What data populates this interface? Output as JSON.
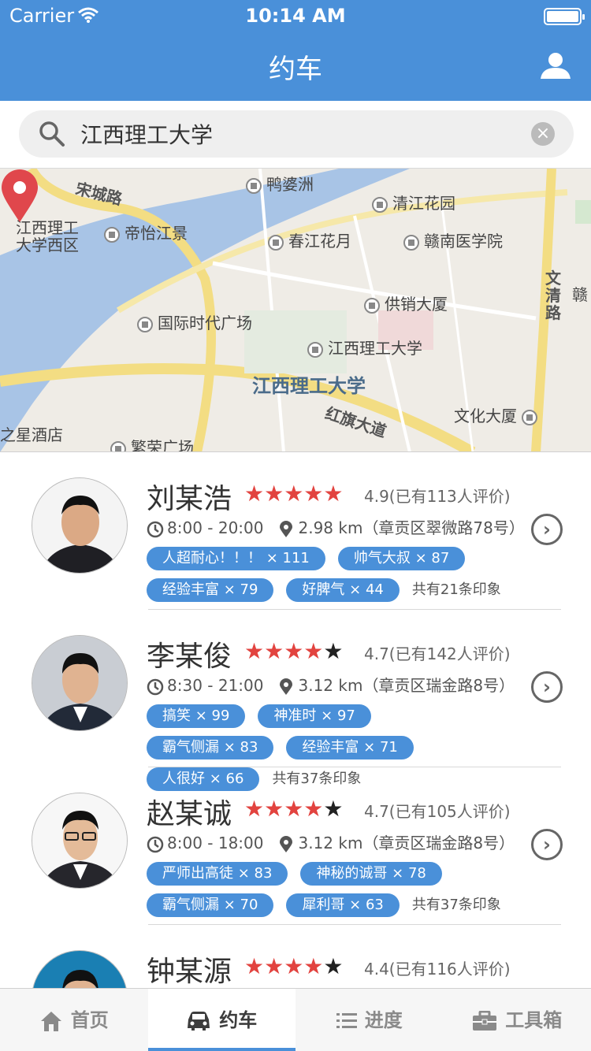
{
  "status": {
    "carrier": "Carrier",
    "time": "10:14 AM"
  },
  "header": {
    "title": "约车"
  },
  "search": {
    "value": "江西理工大学"
  },
  "map": {
    "roads": [
      "宋城路",
      "文清路",
      "红旗大道"
    ],
    "places": [
      "鸭婆洲",
      "清江花园",
      "江西理工大学西区",
      "帝怡江景",
      "春江花月",
      "赣南医学院",
      "供销大厦",
      "国际时代广场",
      "江西理工大学",
      "文化大厦",
      "之星酒店",
      "繁荣广场",
      "赣"
    ],
    "highlight": "江西理工大学"
  },
  "drivers": [
    {
      "name": "刘某浩",
      "stars": "★★★★★",
      "half": "",
      "rating": "4.9(已有113人评价)",
      "hours": "8:00 - 20:00",
      "distance": "2.98 km（章贡区翠微路78号）",
      "tags": [
        "人超耐心！！！ × 111",
        "帅气大叔 × 87",
        "经验丰富 × 79",
        "好脾气 × 44"
      ],
      "impressions": "共有21条印象"
    },
    {
      "name": "李某俊",
      "stars": "★★★★",
      "half": "★",
      "rating": "4.7(已有142人评价)",
      "hours": "8:30 - 21:00",
      "distance": "3.12 km（章贡区瑞金路8号）",
      "tags": [
        "搞笑 × 99",
        "神准时 × 97",
        "霸气侧漏 × 83",
        "经验丰富 × 71",
        "人很好 × 66"
      ],
      "impressions": "共有37条印象"
    },
    {
      "name": "赵某诚",
      "stars": "★★★★",
      "half": "★",
      "rating": "4.7(已有105人评价)",
      "hours": "8:00 - 18:00",
      "distance": "3.12 km（章贡区瑞金路8号）",
      "tags": [
        "严师出高徒 × 83",
        "神秘的诚哥 × 78",
        "霸气侧漏 × 70",
        "犀利哥 × 63"
      ],
      "impressions": "共有37条印象"
    },
    {
      "name": "钟某源",
      "stars": "★★★★",
      "half": "★",
      "rating": "4.4(已有116人评价)",
      "hours": "",
      "distance": "",
      "tags": [],
      "impressions": ""
    }
  ],
  "tabs": [
    {
      "label": "首页",
      "icon": "home-icon"
    },
    {
      "label": "约车",
      "icon": "car-icon"
    },
    {
      "label": "进度",
      "icon": "list-icon"
    },
    {
      "label": "工具箱",
      "icon": "toolbox-icon"
    }
  ],
  "colors": {
    "primary": "#4a90d9",
    "star": "#e2433f",
    "pin": "#e0474c"
  }
}
